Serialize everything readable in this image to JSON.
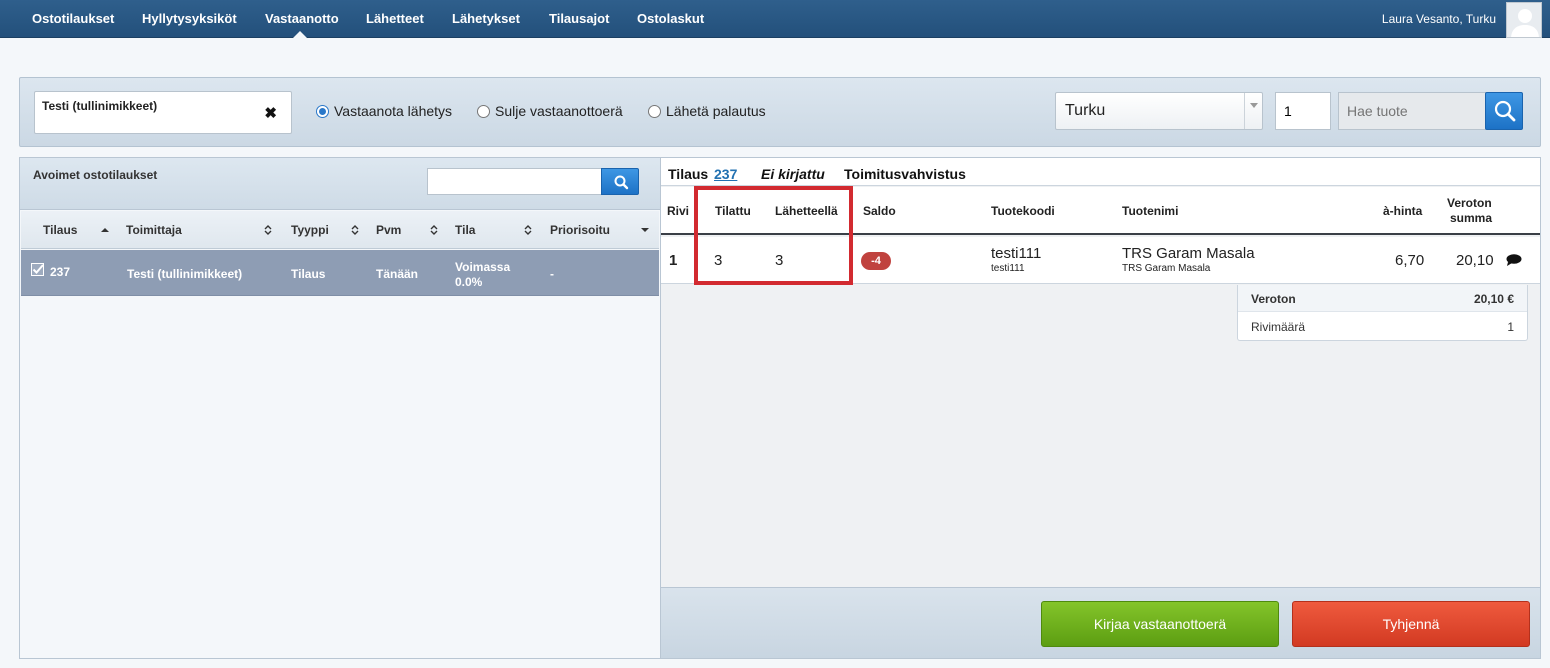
{
  "nav": {
    "items": [
      "Ostotilaukset",
      "Hyllytysyksiköt",
      "Vastaanotto",
      "Lähetteet",
      "Lähetykset",
      "Tilausajot",
      "Ostolaskut"
    ],
    "active": "Vastaanotto",
    "user": "Laura Vesanto, Turku"
  },
  "toolbar": {
    "supplier": "Testi (tullinimikkeet)",
    "clear_icon": "close-icon",
    "radios": [
      {
        "label": "Vastaanota lähetys",
        "selected": true
      },
      {
        "label": "Sulje vastaanottoerä",
        "selected": false
      },
      {
        "label": "Lähetä palautus",
        "selected": false
      }
    ],
    "location": "Turku",
    "quantity": "1",
    "search_placeholder": "Hae tuote"
  },
  "left": {
    "title": "Avoimet ostotilaukset",
    "columns": [
      "Tilaus",
      "Toimittaja",
      "Tyyppi",
      "Pvm",
      "Tila",
      "Priorisoitu"
    ],
    "rows": [
      {
        "tilaus": "237",
        "toimittaja": "Testi (tullinimikkeet)",
        "tyyppi": "Tilaus",
        "pvm": "Tänään",
        "tila_1": "Voimassa",
        "tila_2": "0.0%",
        "priorisoitu": "-"
      }
    ]
  },
  "right": {
    "order_label": "Tilaus",
    "order_number": "237",
    "status": "Ei kirjattu",
    "confirmation": "Toimitusvahvistus",
    "columns": {
      "rivi": "Rivi",
      "tilattu": "Tilattu",
      "lahetteella": "Lähetteellä",
      "saldo": "Saldo",
      "tuotekoodi": "Tuotekoodi",
      "tuotenimi": "Tuotenimi",
      "ahinta": "à-hinta",
      "veroton_1": "Veroton",
      "veroton_2": "summa"
    },
    "rows": [
      {
        "rivi": "1",
        "tilattu": "3",
        "lahetteella": "3",
        "saldo": "-4",
        "code": "testi111",
        "code_sub": "testi111",
        "name": "TRS Garam Masala",
        "name_sub": "TRS Garam Masala",
        "price": "6,70",
        "sum": "20,10"
      }
    ],
    "summary": {
      "veroton_label": "Veroton",
      "veroton_value": "20,10 €",
      "rivimaara_label": "Rivimäärä",
      "rivimaara_value": "1"
    },
    "buttons": {
      "submit": "Kirjaa vastaanottoerä",
      "clear": "Tyhjennä"
    },
    "highlight_color": "#d22a30"
  }
}
